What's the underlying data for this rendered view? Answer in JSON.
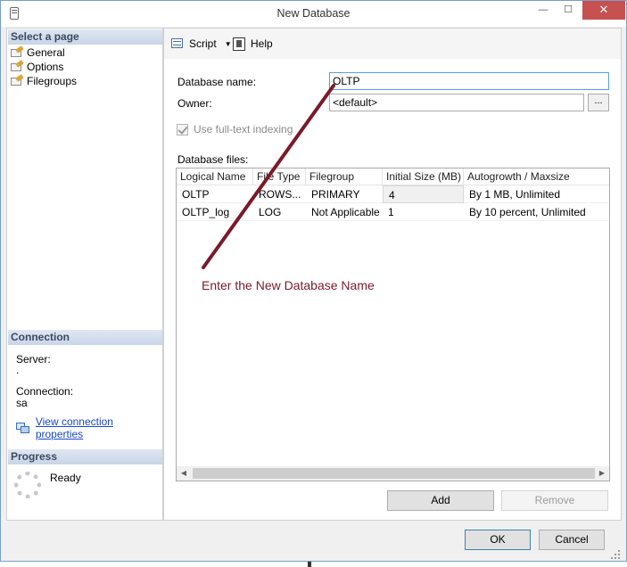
{
  "window": {
    "title": "New Database",
    "minimize_glyph": "—",
    "maximize_glyph": "☐",
    "close_glyph": "✕"
  },
  "left_panel": {
    "select_page_header": "Select a page",
    "pages": [
      {
        "label": "General",
        "icon": "page-wrench-icon",
        "selected": true
      },
      {
        "label": "Options",
        "icon": "page-wrench-icon",
        "selected": false
      },
      {
        "label": "Filegroups",
        "icon": "page-wrench-icon",
        "selected": false
      }
    ],
    "connection_header": "Connection",
    "server_label": "Server:",
    "server_value": ".",
    "connection_label": "Connection:",
    "connection_value": "sa",
    "view_connection_link": "View connection properties",
    "progress_header": "Progress",
    "progress_status": "Ready"
  },
  "toolbar": {
    "script_label": "Script",
    "help_label": "Help"
  },
  "form": {
    "db_name_label": "Database name:",
    "db_name_value": "OLTP",
    "owner_label": "Owner:",
    "owner_value": "<default>",
    "browse_label": "...",
    "fulltext_label": "Use full-text indexing",
    "fulltext_checked": true,
    "db_files_label": "Database files:"
  },
  "grid": {
    "columns": [
      "Logical Name",
      "File Type",
      "Filegroup",
      "Initial Size (MB)",
      "Autogrowth / Maxsize"
    ],
    "rows": [
      [
        "OLTP",
        "ROWS...",
        "PRIMARY",
        "4",
        "By 1 MB, Unlimited"
      ],
      [
        "OLTP_log",
        "LOG",
        "Not Applicable",
        "1",
        "By 10 percent, Unlimited"
      ]
    ]
  },
  "buttons": {
    "add": "Add",
    "remove": "Remove",
    "ok": "OK",
    "cancel": "Cancel"
  },
  "annotation": {
    "text": "Enter the New Database Name",
    "color": "#7a1a2a"
  }
}
